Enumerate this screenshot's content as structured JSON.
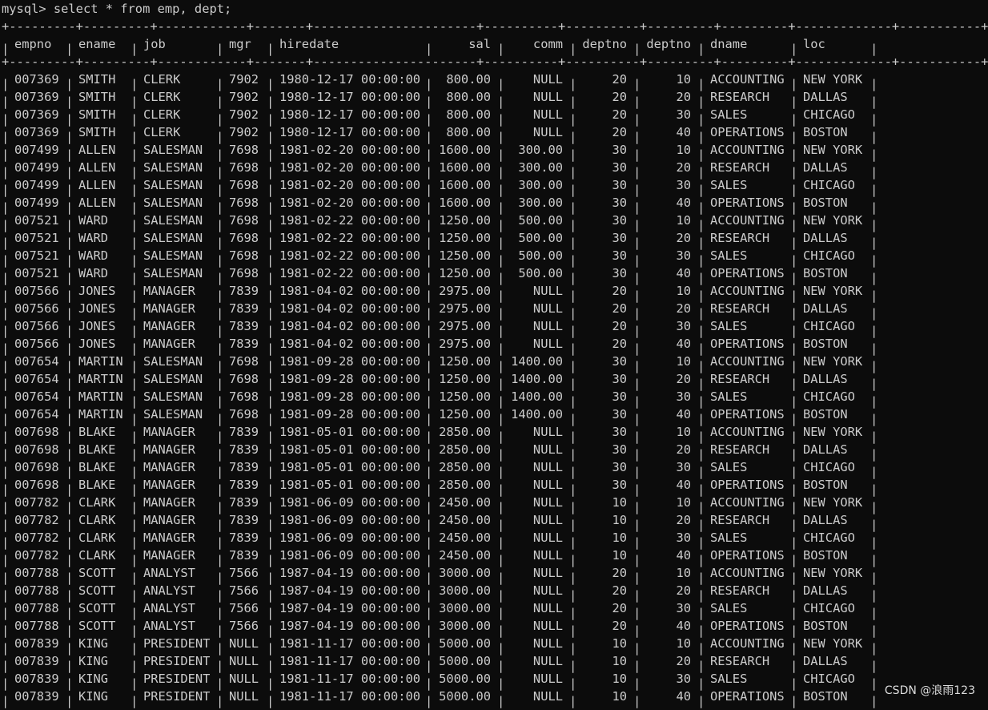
{
  "terminal": {
    "prompt": "mysql> ",
    "command": "select * from emp, dept;",
    "columns": [
      "empno",
      "ename",
      "job",
      "mgr",
      "hiredate",
      "sal",
      "comm",
      "deptno",
      "deptno",
      "dname",
      "loc"
    ],
    "rows": [
      [
        "007369",
        "SMITH",
        "CLERK",
        "7902",
        "1980-12-17 00:00:00",
        "800.00",
        "NULL",
        "20",
        "10",
        "ACCOUNTING",
        "NEW YORK"
      ],
      [
        "007369",
        "SMITH",
        "CLERK",
        "7902",
        "1980-12-17 00:00:00",
        "800.00",
        "NULL",
        "20",
        "20",
        "RESEARCH",
        "DALLAS"
      ],
      [
        "007369",
        "SMITH",
        "CLERK",
        "7902",
        "1980-12-17 00:00:00",
        "800.00",
        "NULL",
        "20",
        "30",
        "SALES",
        "CHICAGO"
      ],
      [
        "007369",
        "SMITH",
        "CLERK",
        "7902",
        "1980-12-17 00:00:00",
        "800.00",
        "NULL",
        "20",
        "40",
        "OPERATIONS",
        "BOSTON"
      ],
      [
        "007499",
        "ALLEN",
        "SALESMAN",
        "7698",
        "1981-02-20 00:00:00",
        "1600.00",
        "300.00",
        "30",
        "10",
        "ACCOUNTING",
        "NEW YORK"
      ],
      [
        "007499",
        "ALLEN",
        "SALESMAN",
        "7698",
        "1981-02-20 00:00:00",
        "1600.00",
        "300.00",
        "30",
        "20",
        "RESEARCH",
        "DALLAS"
      ],
      [
        "007499",
        "ALLEN",
        "SALESMAN",
        "7698",
        "1981-02-20 00:00:00",
        "1600.00",
        "300.00",
        "30",
        "30",
        "SALES",
        "CHICAGO"
      ],
      [
        "007499",
        "ALLEN",
        "SALESMAN",
        "7698",
        "1981-02-20 00:00:00",
        "1600.00",
        "300.00",
        "30",
        "40",
        "OPERATIONS",
        "BOSTON"
      ],
      [
        "007521",
        "WARD",
        "SALESMAN",
        "7698",
        "1981-02-22 00:00:00",
        "1250.00",
        "500.00",
        "30",
        "10",
        "ACCOUNTING",
        "NEW YORK"
      ],
      [
        "007521",
        "WARD",
        "SALESMAN",
        "7698",
        "1981-02-22 00:00:00",
        "1250.00",
        "500.00",
        "30",
        "20",
        "RESEARCH",
        "DALLAS"
      ],
      [
        "007521",
        "WARD",
        "SALESMAN",
        "7698",
        "1981-02-22 00:00:00",
        "1250.00",
        "500.00",
        "30",
        "30",
        "SALES",
        "CHICAGO"
      ],
      [
        "007521",
        "WARD",
        "SALESMAN",
        "7698",
        "1981-02-22 00:00:00",
        "1250.00",
        "500.00",
        "30",
        "40",
        "OPERATIONS",
        "BOSTON"
      ],
      [
        "007566",
        "JONES",
        "MANAGER",
        "7839",
        "1981-04-02 00:00:00",
        "2975.00",
        "NULL",
        "20",
        "10",
        "ACCOUNTING",
        "NEW YORK"
      ],
      [
        "007566",
        "JONES",
        "MANAGER",
        "7839",
        "1981-04-02 00:00:00",
        "2975.00",
        "NULL",
        "20",
        "20",
        "RESEARCH",
        "DALLAS"
      ],
      [
        "007566",
        "JONES",
        "MANAGER",
        "7839",
        "1981-04-02 00:00:00",
        "2975.00",
        "NULL",
        "20",
        "30",
        "SALES",
        "CHICAGO"
      ],
      [
        "007566",
        "JONES",
        "MANAGER",
        "7839",
        "1981-04-02 00:00:00",
        "2975.00",
        "NULL",
        "20",
        "40",
        "OPERATIONS",
        "BOSTON"
      ],
      [
        "007654",
        "MARTIN",
        "SALESMAN",
        "7698",
        "1981-09-28 00:00:00",
        "1250.00",
        "1400.00",
        "30",
        "10",
        "ACCOUNTING",
        "NEW YORK"
      ],
      [
        "007654",
        "MARTIN",
        "SALESMAN",
        "7698",
        "1981-09-28 00:00:00",
        "1250.00",
        "1400.00",
        "30",
        "20",
        "RESEARCH",
        "DALLAS"
      ],
      [
        "007654",
        "MARTIN",
        "SALESMAN",
        "7698",
        "1981-09-28 00:00:00",
        "1250.00",
        "1400.00",
        "30",
        "30",
        "SALES",
        "CHICAGO"
      ],
      [
        "007654",
        "MARTIN",
        "SALESMAN",
        "7698",
        "1981-09-28 00:00:00",
        "1250.00",
        "1400.00",
        "30",
        "40",
        "OPERATIONS",
        "BOSTON"
      ],
      [
        "007698",
        "BLAKE",
        "MANAGER",
        "7839",
        "1981-05-01 00:00:00",
        "2850.00",
        "NULL",
        "30",
        "10",
        "ACCOUNTING",
        "NEW YORK"
      ],
      [
        "007698",
        "BLAKE",
        "MANAGER",
        "7839",
        "1981-05-01 00:00:00",
        "2850.00",
        "NULL",
        "30",
        "20",
        "RESEARCH",
        "DALLAS"
      ],
      [
        "007698",
        "BLAKE",
        "MANAGER",
        "7839",
        "1981-05-01 00:00:00",
        "2850.00",
        "NULL",
        "30",
        "30",
        "SALES",
        "CHICAGO"
      ],
      [
        "007698",
        "BLAKE",
        "MANAGER",
        "7839",
        "1981-05-01 00:00:00",
        "2850.00",
        "NULL",
        "30",
        "40",
        "OPERATIONS",
        "BOSTON"
      ],
      [
        "007782",
        "CLARK",
        "MANAGER",
        "7839",
        "1981-06-09 00:00:00",
        "2450.00",
        "NULL",
        "10",
        "10",
        "ACCOUNTING",
        "NEW YORK"
      ],
      [
        "007782",
        "CLARK",
        "MANAGER",
        "7839",
        "1981-06-09 00:00:00",
        "2450.00",
        "NULL",
        "10",
        "20",
        "RESEARCH",
        "DALLAS"
      ],
      [
        "007782",
        "CLARK",
        "MANAGER",
        "7839",
        "1981-06-09 00:00:00",
        "2450.00",
        "NULL",
        "10",
        "30",
        "SALES",
        "CHICAGO"
      ],
      [
        "007782",
        "CLARK",
        "MANAGER",
        "7839",
        "1981-06-09 00:00:00",
        "2450.00",
        "NULL",
        "10",
        "40",
        "OPERATIONS",
        "BOSTON"
      ],
      [
        "007788",
        "SCOTT",
        "ANALYST",
        "7566",
        "1987-04-19 00:00:00",
        "3000.00",
        "NULL",
        "20",
        "10",
        "ACCOUNTING",
        "NEW YORK"
      ],
      [
        "007788",
        "SCOTT",
        "ANALYST",
        "7566",
        "1987-04-19 00:00:00",
        "3000.00",
        "NULL",
        "20",
        "20",
        "RESEARCH",
        "DALLAS"
      ],
      [
        "007788",
        "SCOTT",
        "ANALYST",
        "7566",
        "1987-04-19 00:00:00",
        "3000.00",
        "NULL",
        "20",
        "30",
        "SALES",
        "CHICAGO"
      ],
      [
        "007788",
        "SCOTT",
        "ANALYST",
        "7566",
        "1987-04-19 00:00:00",
        "3000.00",
        "NULL",
        "20",
        "40",
        "OPERATIONS",
        "BOSTON"
      ],
      [
        "007839",
        "KING",
        "PRESIDENT",
        "NULL",
        "1981-11-17 00:00:00",
        "5000.00",
        "NULL",
        "10",
        "10",
        "ACCOUNTING",
        "NEW YORK"
      ],
      [
        "007839",
        "KING",
        "PRESIDENT",
        "NULL",
        "1981-11-17 00:00:00",
        "5000.00",
        "NULL",
        "10",
        "20",
        "RESEARCH",
        "DALLAS"
      ],
      [
        "007839",
        "KING",
        "PRESIDENT",
        "NULL",
        "1981-11-17 00:00:00",
        "5000.00",
        "NULL",
        "10",
        "30",
        "SALES",
        "CHICAGO"
      ],
      [
        "007839",
        "KING",
        "PRESIDENT",
        "NULL",
        "1981-11-17 00:00:00",
        "5000.00",
        "NULL",
        "10",
        "40",
        "OPERATIONS",
        "BOSTON"
      ]
    ]
  },
  "watermark": "CSDN @浪雨123",
  "colors": {
    "background": "#0c0c0c",
    "text": "#cccccc"
  }
}
